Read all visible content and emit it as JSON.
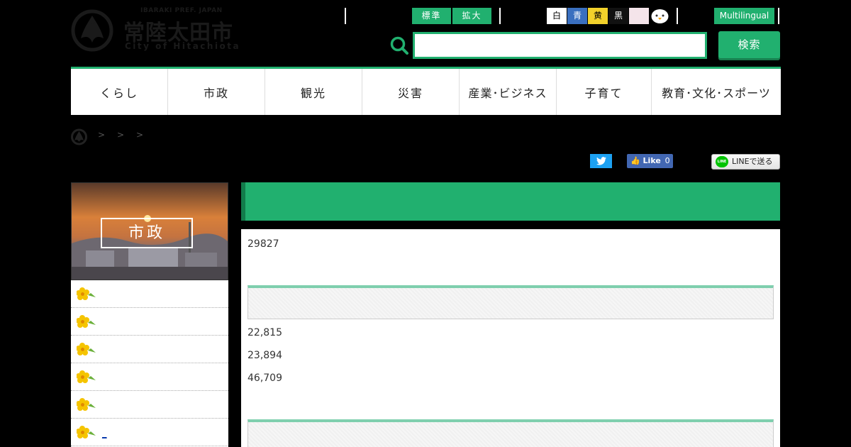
{
  "header": {
    "logo": {
      "en_top": "IBARAKI PREF. JAPAN",
      "jp_name": "常陸太田市",
      "en_name": "City of Hitachiota"
    },
    "font_size": {
      "standard": "標準",
      "large": "拡大"
    },
    "color_modes": [
      {
        "label": "白",
        "color": "#ffffff"
      },
      {
        "label": "青",
        "color": "#3a6fbf"
      },
      {
        "label": "黄",
        "color": "#f2d12b"
      },
      {
        "label": "黒",
        "color": "#111111"
      }
    ],
    "multilingual": "Multilingual",
    "search": {
      "placeholder": "",
      "value": "",
      "button": "検索"
    },
    "accent_color": "#21b06f"
  },
  "nav": [
    "くらし",
    "市政",
    "観光",
    "災害",
    "産業･ビジネス",
    "子育て",
    "教育･文化･スポーツ"
  ],
  "breadcrumb": {
    "separators": [
      ">",
      ">",
      ">"
    ]
  },
  "social": {
    "facebook": {
      "label": "Like",
      "count": "0"
    },
    "line": {
      "badge": "LINE",
      "label": "LINEで送る"
    }
  },
  "sidebar": {
    "hero_label": "市政",
    "items": [
      {
        "label": ""
      },
      {
        "label": ""
      },
      {
        "label": ""
      },
      {
        "label": ""
      },
      {
        "label": ""
      },
      {
        "label": "_"
      }
    ]
  },
  "main": {
    "title": "",
    "page_id": "29827",
    "stats": [
      "22,815",
      "23,894",
      "46,709"
    ]
  }
}
